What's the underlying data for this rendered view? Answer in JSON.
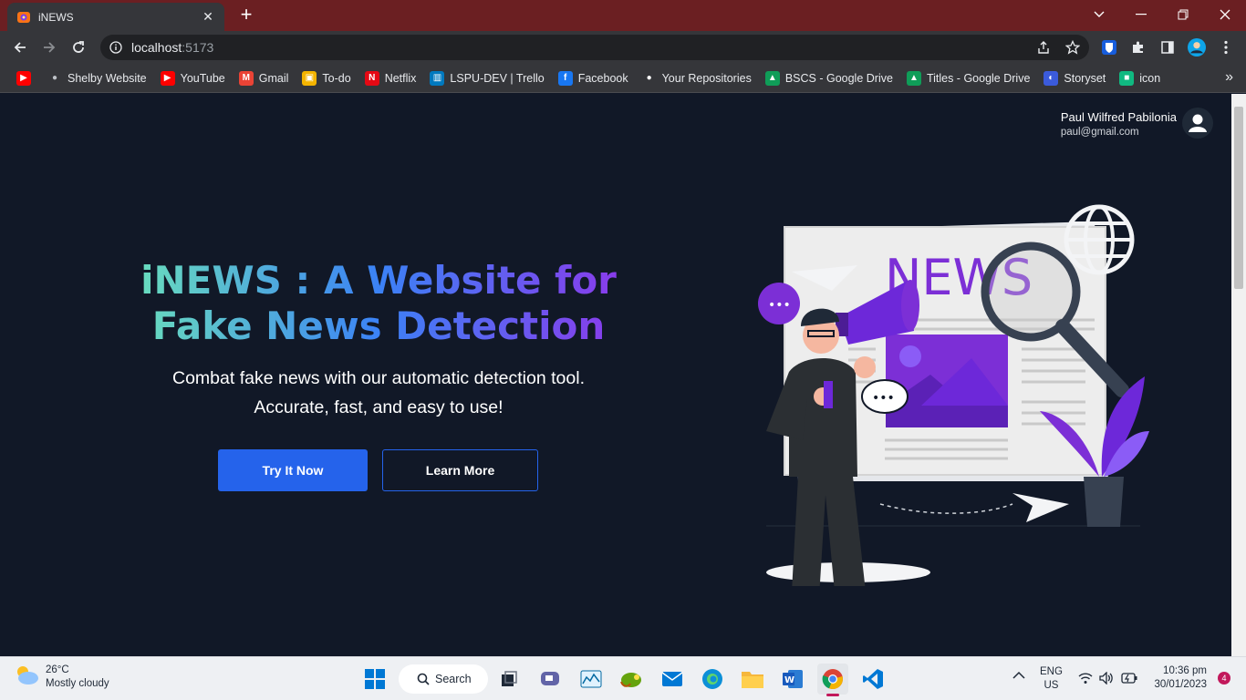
{
  "browser": {
    "tab_title": "iNEWS",
    "url_host": "localhost",
    "url_port": ":5173",
    "bookmarks": [
      {
        "label": "",
        "icon": "youtube-icon",
        "color": "#ff0000"
      },
      {
        "label": "Shelby Website",
        "icon": "globe-icon",
        "color": "#5f6368"
      },
      {
        "label": "YouTube",
        "icon": "youtube-icon",
        "color": "#ff0000"
      },
      {
        "label": "Gmail",
        "icon": "gmail-icon",
        "color": "#ea4335"
      },
      {
        "label": "To-do",
        "icon": "classroom-icon",
        "color": "#f4b400"
      },
      {
        "label": "Netflix",
        "icon": "netflix-icon",
        "color": "#e50914"
      },
      {
        "label": "LSPU-DEV | Trello",
        "icon": "trello-icon",
        "color": "#0079bf"
      },
      {
        "label": "Facebook",
        "icon": "facebook-icon",
        "color": "#1877f2"
      },
      {
        "label": "Your Repositories",
        "icon": "github-icon",
        "color": "#ffffff"
      },
      {
        "label": "BSCS - Google Drive",
        "icon": "drive-icon",
        "color": "#0f9d58"
      },
      {
        "label": "Titles - Google Drive",
        "icon": "drive-icon",
        "color": "#0f9d58"
      },
      {
        "label": "Storyset",
        "icon": "storyset-icon",
        "color": "#3b5bdb"
      },
      {
        "label": "icon",
        "icon": "icon-site-icon",
        "color": "#10b981"
      }
    ]
  },
  "page": {
    "user": {
      "name": "Paul Wilfred Pabilonia",
      "email": "paul@gmail.com"
    },
    "hero": {
      "title_line1": "iNEWS : A Website for",
      "title_line2": "Fake News Detection",
      "subtitle_line1": "Combat fake news with our automatic detection tool.",
      "subtitle_line2": "Accurate, fast, and easy to use!",
      "primary_button": "Try It Now",
      "secondary_button": "Learn More"
    },
    "illustration": {
      "newspaper_heading": "NEWS"
    },
    "colors": {
      "accent_blue": "#2563eb",
      "accent_purple": "#7c2fd6",
      "background": "#111827"
    }
  },
  "taskbar": {
    "weather_temp": "26°C",
    "weather_desc": "Mostly cloudy",
    "search_label": "Search",
    "lang_line1": "ENG",
    "lang_line2": "US",
    "time": "10:36 pm",
    "date": "30/01/2023",
    "notification_count": "4"
  }
}
